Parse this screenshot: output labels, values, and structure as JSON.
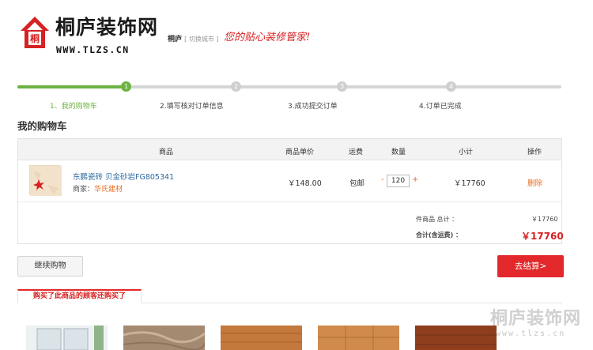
{
  "header": {
    "logo_icon_char": "桐",
    "logo_title": "桐庐装饰网",
    "logo_url": "WWW.TLZS.CN",
    "city": "桐庐",
    "switch_city": "[ 切换城市 ]",
    "slogan": "您的贴心装修管家!"
  },
  "progress": {
    "steps": [
      {
        "num": "1",
        "label": "1、我的购物车"
      },
      {
        "num": "2",
        "label": "2.填写核对订单信息"
      },
      {
        "num": "3",
        "label": "3.成功提交订单"
      },
      {
        "num": "4",
        "label": "4.订单已完成"
      }
    ],
    "active_step": 1
  },
  "cart": {
    "title": "我的购物车",
    "headers": {
      "product": "商品",
      "unit_price": "商品单价",
      "shipping": "运费",
      "quantity": "数量",
      "subtotal": "小计",
      "action": "操作"
    },
    "items": [
      {
        "name": "东鹏瓷砖 贝金砂岩FG805341",
        "merchant_label": "商家：",
        "merchant": "华氏建材",
        "unit_price": "￥148.00",
        "shipping": "包邮",
        "quantity": "120",
        "qty_minus": "-",
        "qty_plus": "+",
        "subtotal": "￥17760",
        "delete": "删除"
      }
    ],
    "summary": {
      "count_label": "件商品 总计 ：",
      "count_value": "￥17760",
      "total_label": "合计(含运费) ：",
      "total_value": "￥17760"
    }
  },
  "buttons": {
    "continue": "继续购物",
    "checkout": "去结算>"
  },
  "recommend": {
    "tab": "购买了此商品的顾客还购买了"
  },
  "watermark": {
    "title": "桐庐装饰网",
    "url": "www.tlzs.cn"
  },
  "colors": {
    "accent_green": "#6cb342",
    "accent_red": "#e3282b",
    "link_blue": "#2c6aa0",
    "orange": "#e86c1f"
  }
}
